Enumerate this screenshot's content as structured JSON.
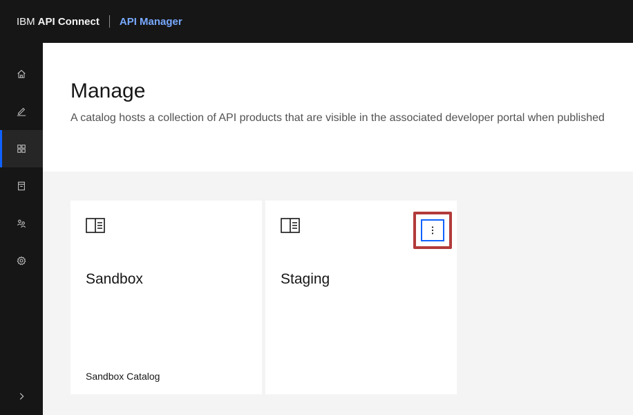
{
  "topbar": {
    "brand_prefix": "IBM",
    "brand_product": "API Connect",
    "app_name": "API Manager"
  },
  "sidenav": {
    "items": [
      {
        "icon": "home-icon"
      },
      {
        "icon": "edit-icon"
      },
      {
        "icon": "grid-icon",
        "active": true
      },
      {
        "icon": "document-icon"
      },
      {
        "icon": "users-icon"
      },
      {
        "icon": "gear-icon"
      },
      {
        "icon": "chevron-right-icon"
      }
    ]
  },
  "page": {
    "title": "Manage",
    "description": "A catalog hosts a collection of API products that are visible in the associated developer portal when published"
  },
  "cards": [
    {
      "title": "Sandbox",
      "subtitle": "Sandbox Catalog"
    },
    {
      "title": "Staging",
      "subtitle": ""
    }
  ],
  "colors": {
    "topbar_bg": "#161616",
    "accent": "#0f62fe",
    "app_name": "#78a9ff",
    "highlight": "#b23b3b"
  }
}
